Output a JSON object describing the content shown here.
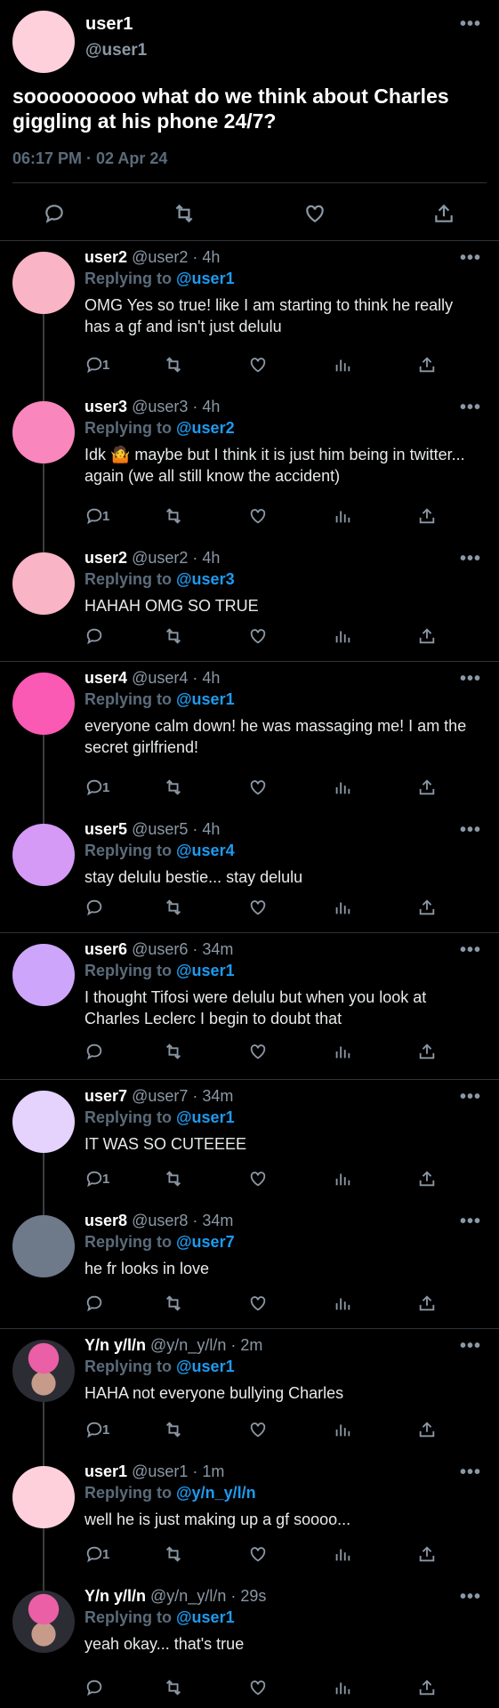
{
  "main_tweet": {
    "name": "user1",
    "handle": "@user1",
    "text": "sooooooooo what do we think about Charles giggling at his phone 24/7?",
    "timestamp": "06:17 PM · 02 Apr 24",
    "more": "•••"
  },
  "icons": [
    "reply-icon",
    "retweet-icon",
    "like-icon",
    "views-icon",
    "share-icon",
    "more-icon"
  ],
  "replies": [
    {
      "name": "user2",
      "meta": "@user2 · 4h",
      "replying_prefix": "Replying to ",
      "replying_to": "@user1",
      "text": "OMG Yes so true! like I am starting to think he really has a gf and isn't just delulu",
      "reply_count": "1",
      "avatar_color": "#f9b4c6"
    },
    {
      "name": "user3",
      "meta": "@user3 · 4h",
      "replying_prefix": "Replying to ",
      "replying_to": "@user2",
      "text": "Idk 🤷 maybe but I think it is just him being in twitter... again (we all still know the accident)",
      "reply_count": "1",
      "avatar_color": "#f987bd"
    },
    {
      "name": "user2",
      "meta": "@user2 · 4h",
      "replying_prefix": "Replying to ",
      "replying_to": "@user3",
      "text": "HAHAH OMG SO TRUE",
      "reply_count": "",
      "avatar_color": "#f9b4c6"
    },
    {
      "name": "user4",
      "meta": "@user4 · 4h",
      "replying_prefix": "Replying to ",
      "replying_to": "@user1",
      "text": "everyone calm down! he was massaging me! I am the secret girlfriend!",
      "reply_count": "1",
      "avatar_color": "#fa59b4"
    },
    {
      "name": "user5",
      "meta": "@user5 · 4h",
      "replying_prefix": "Replying to ",
      "replying_to": "@user4",
      "text": "stay delulu bestie... stay delulu",
      "reply_count": "",
      "avatar_color": "#d49af6"
    },
    {
      "name": "user6",
      "meta": "@user6 · 34m",
      "replying_prefix": "Replying to ",
      "replying_to": "@user1",
      "text": "I thought Tifosi were delulu but when you look at Charles Leclerc I begin to doubt that",
      "reply_count": "",
      "avatar_color": "#cda6fc"
    },
    {
      "name": "user7",
      "meta": "@user7 · 34m",
      "replying_prefix": "Replying to ",
      "replying_to": "@user1",
      "text": "IT WAS SO CUTEEEE",
      "reply_count": "1",
      "avatar_color": "#e5d2fd"
    },
    {
      "name": "user8",
      "meta": "@user8 · 34m",
      "replying_prefix": "Replying to ",
      "replying_to": "@user7",
      "text": "he fr looks in love",
      "reply_count": "",
      "avatar_color": "#6e7a8a"
    },
    {
      "name": "Y/n y/l/n",
      "meta": "@y/n_y/l/n · 2m",
      "replying_prefix": "Replying to ",
      "replying_to": "@user1",
      "text": "HAHA not everyone bullying Charles",
      "reply_count": "1",
      "avatar_color": "#2c2c34"
    },
    {
      "name": "user1",
      "meta": "@user1 · 1m",
      "replying_prefix": "Replying to ",
      "replying_to": "@y/n_y/l/n",
      "text": "well he is just making up a gf soooo...",
      "reply_count": "1",
      "avatar_color": "#fdd0dc"
    },
    {
      "name": "Y/n y/l/n",
      "meta": "@y/n_y/l/n · 29s",
      "replying_prefix": "Replying to ",
      "replying_to": "@user1",
      "text": "yeah okay... that's true",
      "reply_count": "",
      "avatar_color": "#2c2c34"
    }
  ]
}
